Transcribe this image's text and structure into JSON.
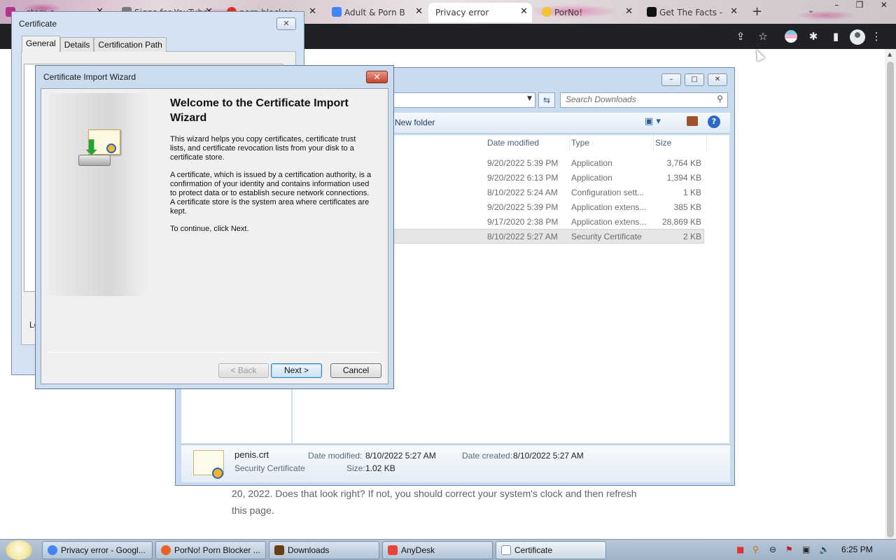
{
  "browser": {
    "tabs": [
      {
        "label": "...stem.s...",
        "active": false,
        "favicon_color": "#b5338a"
      },
      {
        "label": "Signs for YouTube",
        "active": false,
        "favicon_color": "#7a7a7a"
      },
      {
        "label": "porn blocker",
        "active": false,
        "favicon_color": "#d93025"
      },
      {
        "label": "Adult & Porn B",
        "active": false,
        "favicon_color": "#4285f4"
      },
      {
        "label": "Privacy error",
        "active": true,
        "favicon_color": "#ffffff"
      },
      {
        "label": "PorNo!",
        "active": false,
        "favicon_color": "#f2c230"
      },
      {
        "label": "Get The Facts -",
        "active": false,
        "favicon_color": "#111111"
      }
    ],
    "page_text": "20, 2022. Does that look right? If not, you should correct your system's clock and then refresh this page."
  },
  "explorer": {
    "search_placeholder": "Search Downloads",
    "new_folder_label": "New folder",
    "columns": {
      "date": "Date modified",
      "type": "Type",
      "size": "Size"
    },
    "rows": [
      {
        "date": "9/20/2022 5:39 PM",
        "type": "Application",
        "size": "3,764 KB",
        "selected": false
      },
      {
        "date": "9/20/2022 6:13 PM",
        "type": "Application",
        "size": "1,394 KB",
        "selected": false
      },
      {
        "date": "8/10/2022 5:24 AM",
        "type": "Configuration sett...",
        "size": "1 KB",
        "selected": false
      },
      {
        "date": "9/20/2022 5:39 PM",
        "type": "Application extens...",
        "size": "385 KB",
        "selected": false
      },
      {
        "date": "9/17/2020 2:38 PM",
        "type": "Application extens...",
        "size": "28,869 KB",
        "selected": false
      },
      {
        "date": "8/10/2022 5:27 AM",
        "type": "Security Certificate",
        "size": "2 KB",
        "selected": true
      }
    ],
    "details": {
      "filename": "penis.crt",
      "filetype": "Security Certificate",
      "date_modified_label": "Date modified:",
      "date_modified": "8/10/2022 5:27 AM",
      "date_created_label": "Date created:",
      "date_created": "8/10/2022 5:27 AM",
      "size_label": "Size:",
      "size": "1.02 KB"
    }
  },
  "cert_dialog": {
    "title": "Certificate",
    "tabs": [
      "General",
      "Details",
      "Certification Path"
    ],
    "partial_text": "Le"
  },
  "wizard": {
    "title": "Certificate Import Wizard",
    "heading": "Welcome to the Certificate Import Wizard",
    "para1": "This wizard helps you copy certificates, certificate trust lists, and certificate revocation lists from your disk to a certificate store.",
    "para2": "A certificate, which is issued by a certification authority, is a confirmation of your identity and contains information used to protect data or to establish secure network connections. A certificate store is the system area where certificates are kept.",
    "para3": "To continue, click Next.",
    "back_label": "< Back",
    "next_label": "Next >",
    "cancel_label": "Cancel"
  },
  "taskbar": {
    "items": [
      {
        "label": "Privacy error - Googl...",
        "icon": "chrome-icon",
        "color": "#4285f4"
      },
      {
        "label": "PorNo! Porn Blocker ...",
        "icon": "firefox-icon",
        "color": "#e8632a"
      },
      {
        "label": "Downloads",
        "icon": "folder-icon",
        "color": "#6b3e1a"
      },
      {
        "label": "AnyDesk",
        "icon": "anydesk-icon",
        "color": "#e5453d"
      },
      {
        "label": "Certificate",
        "icon": "certificate-icon",
        "color": "#ffffff"
      }
    ],
    "clock": "6:25 PM"
  }
}
